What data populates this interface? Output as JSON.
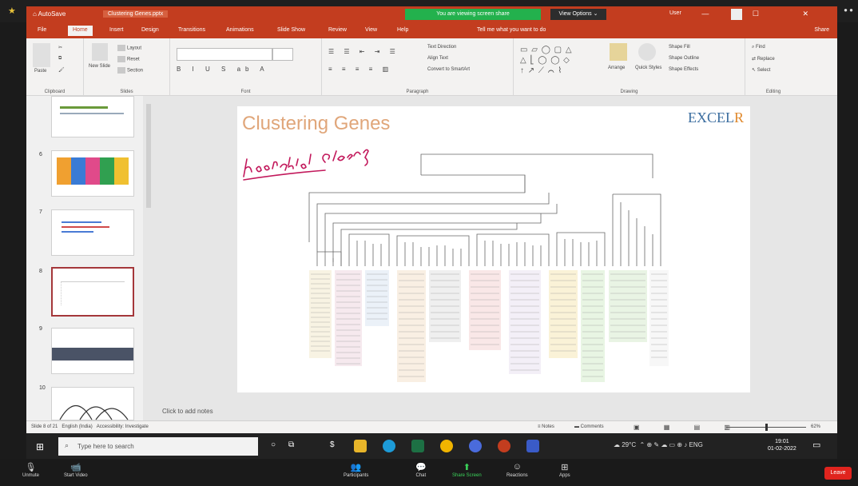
{
  "app": {
    "quick_access": "⌂ AutoSave",
    "filename": "Clustering Genes.pptx",
    "share_banner": "You are viewing screen share",
    "view_options": "View Options ⌄",
    "user_name": "User",
    "window_controls": "— ☐ ✕"
  },
  "tabs": [
    {
      "label": "File"
    },
    {
      "label": "Home"
    },
    {
      "label": "Insert"
    },
    {
      "label": "Design"
    },
    {
      "label": "Transitions"
    },
    {
      "label": "Animations"
    },
    {
      "label": "Slide Show"
    },
    {
      "label": "Review"
    },
    {
      "label": "View"
    },
    {
      "label": "Help"
    },
    {
      "label": "Tell me what you want to do"
    }
  ],
  "share_label": "Share",
  "ribbon": {
    "groups": [
      "Clipboard",
      "Slides",
      "Font",
      "Paragraph",
      "Drawing",
      "Editing"
    ],
    "clipboard": {
      "paste": "Paste"
    },
    "slides": {
      "new_slide": "New Slide",
      "layout": "Layout",
      "reset": "Reset",
      "section": "Section"
    },
    "paragraph": {
      "text_direction": "Text Direction",
      "align_text": "Align Text",
      "smartart": "Convert to SmartArt"
    },
    "drawing": {
      "arrange": "Arrange",
      "quick_styles": "Quick Styles",
      "fill": "Shape Fill",
      "outline": "Shape Outline",
      "effects": "Shape Effects"
    },
    "editing": {
      "find": "Find",
      "replace": "Replace",
      "select": "Select"
    }
  },
  "thumbnails": [
    {
      "number": ""
    },
    {
      "number": "6"
    },
    {
      "number": "7"
    },
    {
      "number": "8"
    },
    {
      "number": "9"
    },
    {
      "number": "10"
    }
  ],
  "slide": {
    "title": "Clustering Genes",
    "logo_main": "EXCEL",
    "logo_accent": "R"
  },
  "notes_placeholder": "Click to add notes",
  "statusbar": {
    "slide_info": "Slide 8 of 21",
    "language": "English (India)",
    "accessibility": "Accessibility: Investigate",
    "notes": "Notes",
    "comments": "Comments",
    "zoom": "62%"
  },
  "taskbar": {
    "search_placeholder": "Type here to search",
    "weather": "29°C",
    "time": "19:01",
    "date": "01-02-2022"
  },
  "zoom_controls": [
    {
      "label": "Unmute",
      "icon": "microphone-icon"
    },
    {
      "label": "Start Video",
      "icon": "camera-icon"
    },
    {
      "label": "Participants",
      "icon": "participants-icon"
    },
    {
      "label": "Chat",
      "icon": "chat-icon"
    },
    {
      "label": "Share Screen",
      "icon": "share-screen-icon"
    },
    {
      "label": "Reactions",
      "icon": "reactions-icon"
    },
    {
      "label": "Apps",
      "icon": "apps-icon"
    }
  ],
  "end_label": "Leave",
  "colors": {
    "ppt_accent": "#c33d1f",
    "share_banner": "#23b14d",
    "end_button": "#e0241e",
    "slide_title": "#e0a67a",
    "logo": "#3c6ea0",
    "annotation_ink": "#c2185b"
  }
}
